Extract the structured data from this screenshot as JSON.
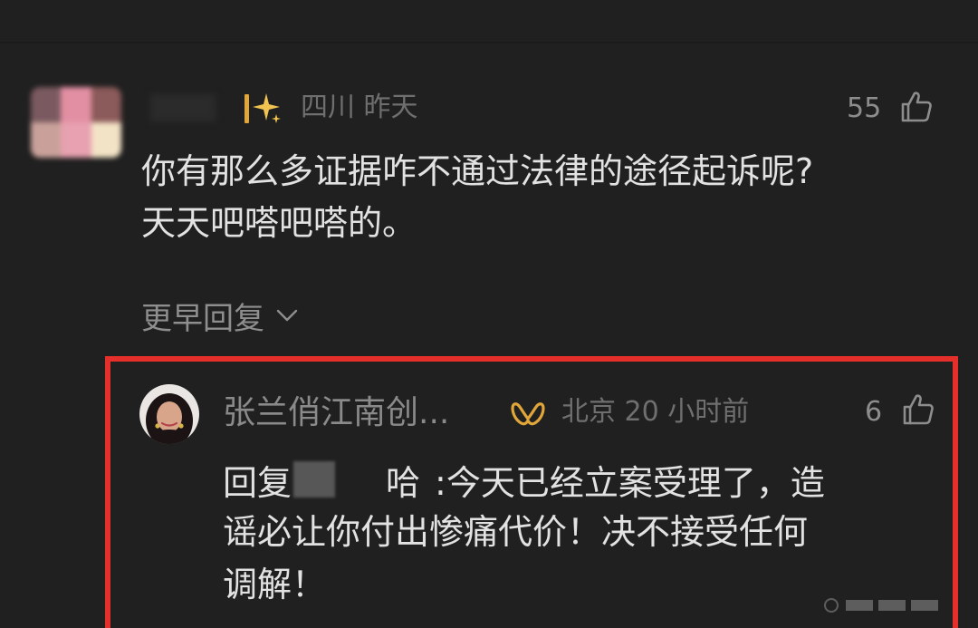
{
  "comment": {
    "location": "四川",
    "time": "昨天",
    "likes": "55",
    "text_line1": "你有那么多证据咋不通过法律的途径起诉呢?",
    "text_line2": "天天吧嗒吧嗒的。"
  },
  "earlier_replies": {
    "label": "更早回复"
  },
  "reply": {
    "author": "张兰俏江南创...",
    "location": "北京",
    "time": "20 小时前",
    "likes": "6",
    "prefix": "回复",
    "name_suffix": "哈",
    "line1_tail": ":今天已经立案受理了，造",
    "line2": "谣必让你付出惨痛代价！决不接受任何",
    "line3": "调解！"
  },
  "colors": {
    "background": "#202020",
    "highlight_border": "#e42f2b",
    "meta_text": "#6f6f6f",
    "body_text": "#e2e2e2",
    "badge_gold": "#e0a63a"
  },
  "icons": {
    "sparkle": "sparkle-badge-icon",
    "vip": "vip-badge-icon",
    "like": "thumbs-up-icon",
    "expand": "chevron-down-icon"
  }
}
